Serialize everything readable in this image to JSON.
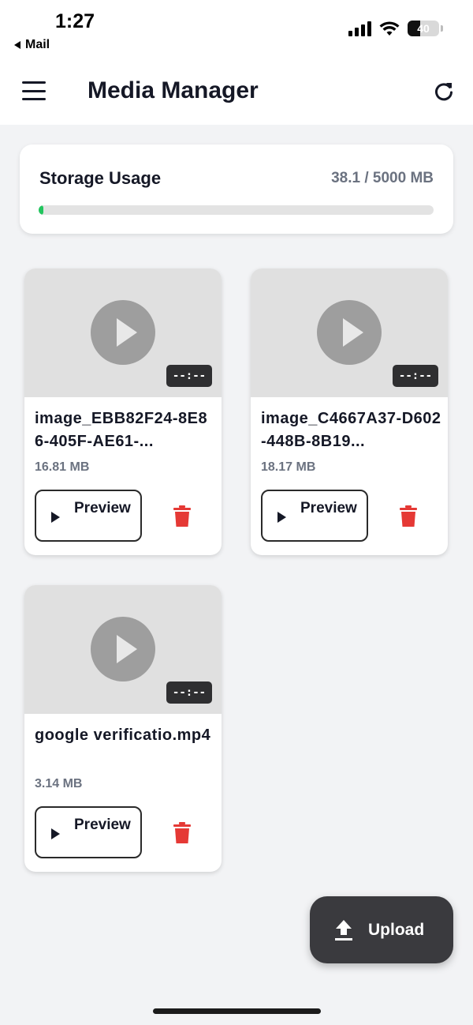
{
  "status_bar": {
    "time": "1:27",
    "back_app": "Mail",
    "battery_level": "40",
    "battery_fraction": 0.4
  },
  "header": {
    "title": "Media Manager",
    "menu_icon": "hamburger-menu-icon",
    "refresh_icon": "refresh-icon"
  },
  "storage": {
    "title": "Storage Usage",
    "usage_text": "38.1 / 5000 MB",
    "used_mb": 38.1,
    "total_mb": 5000,
    "bar_color": "#22c55e"
  },
  "media_items": [
    {
      "name": "image_EBB82F24-8E86-405F-AE61-...",
      "size": "16.81 MB",
      "duration": "--:--",
      "preview_label": "Preview"
    },
    {
      "name": "image_C4667A37-D602-448B-8B19...",
      "size": "18.17 MB",
      "duration": "--:--",
      "preview_label": "Preview"
    },
    {
      "name": "google verificatio.mp4",
      "size": "3.14 MB",
      "duration": "--:--",
      "preview_label": "Preview"
    }
  ],
  "upload": {
    "label": "Upload",
    "icon": "upload-icon"
  },
  "colors": {
    "delete": "#e53935",
    "fab_background": "#3a3a3e",
    "text_primary": "#151826",
    "text_secondary": "#6b7280"
  }
}
